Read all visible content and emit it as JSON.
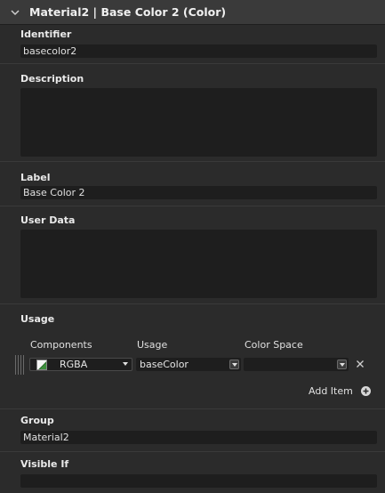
{
  "header": {
    "title": "Material2 | Base Color 2 (Color)"
  },
  "identifier": {
    "label": "Identifier",
    "value": "basecolor2"
  },
  "description": {
    "label": "Description",
    "value": ""
  },
  "label_field": {
    "label": "Label",
    "value": "Base Color 2"
  },
  "user_data": {
    "label": "User Data",
    "value": ""
  },
  "usage": {
    "label": "Usage",
    "columns": {
      "components": "Components",
      "usage": "Usage",
      "color_space": "Color Space"
    },
    "row": {
      "components": "RGBA",
      "usage": "baseColor",
      "color_space": ""
    },
    "add_item": "Add Item"
  },
  "group": {
    "label": "Group",
    "value": "Material2"
  },
  "visible_if": {
    "label": "Visible If",
    "value": ""
  },
  "colors": {
    "background": "#2b2b2b",
    "field": "#1e1e1e",
    "header": "#3a3a3a"
  }
}
